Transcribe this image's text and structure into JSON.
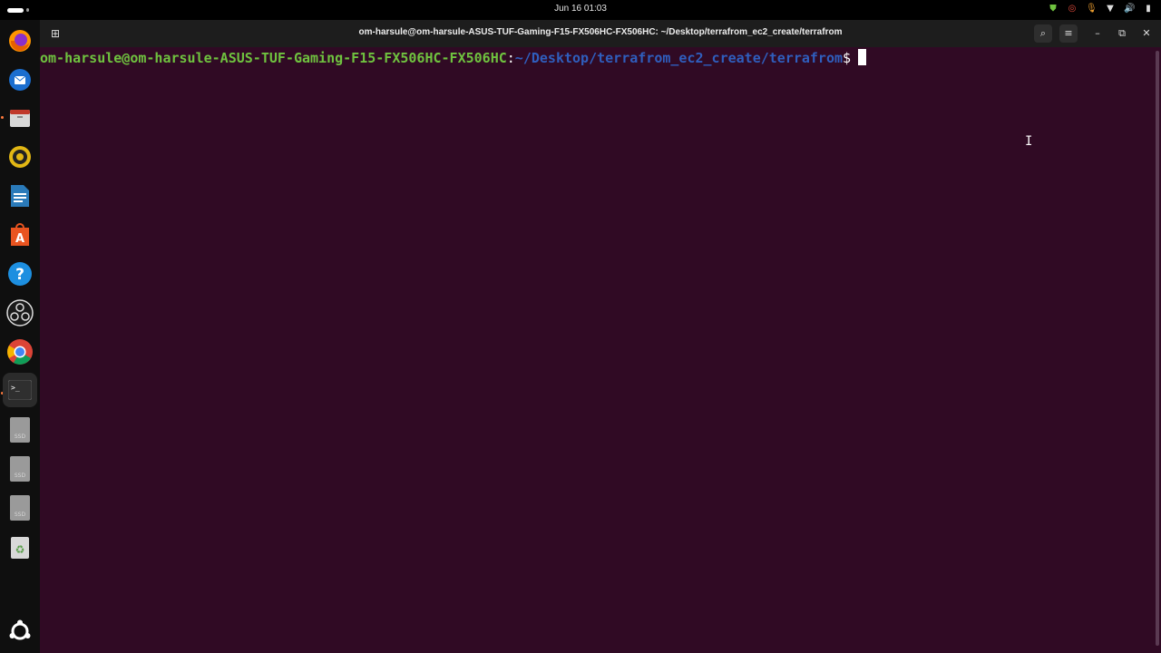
{
  "topbar": {
    "clock": "Jun 16  01:03",
    "tray_icons": [
      "shield-icon",
      "chrome-indicator-icon",
      "microphone-icon",
      "wifi-icon",
      "volume-icon",
      "battery-icon"
    ]
  },
  "dock": {
    "items": [
      {
        "name": "firefox",
        "icon": "firefox-icon",
        "glyph": "🦊",
        "color": "#e66000"
      },
      {
        "name": "thunderbird",
        "icon": "thunderbird-icon",
        "glyph": "✉",
        "color": "#1b6ecf"
      },
      {
        "name": "files",
        "icon": "files-icon",
        "glyph": "▭",
        "color": "#c0392b"
      },
      {
        "name": "rhythmbox",
        "icon": "rhythmbox-icon",
        "glyph": "◉",
        "color": "#e2b714"
      },
      {
        "name": "writer",
        "icon": "libreoffice-writer-icon",
        "glyph": "≣",
        "color": "#2a7ab9"
      },
      {
        "name": "app-center",
        "icon": "app-center-icon",
        "glyph": "A",
        "color": "#e95420"
      },
      {
        "name": "help",
        "icon": "help-icon",
        "glyph": "?",
        "color": "#1d8fe0"
      },
      {
        "name": "obs",
        "icon": "obs-studio-icon",
        "glyph": "◎",
        "color": "#2b2b2b"
      },
      {
        "name": "chrome",
        "icon": "chrome-icon",
        "glyph": "◎",
        "color": "#db4437"
      },
      {
        "name": "terminal",
        "icon": "terminal-icon",
        "glyph": ">_",
        "color": "#2b2b2b"
      },
      {
        "name": "ssd-1",
        "icon": "drive-icon",
        "glyph": "SSD",
        "color": "#8a8a8a"
      },
      {
        "name": "ssd-2",
        "icon": "drive-icon",
        "glyph": "SSD",
        "color": "#8a8a8a"
      },
      {
        "name": "ssd-3",
        "icon": "drive-icon",
        "glyph": "SSD",
        "color": "#8a8a8a"
      },
      {
        "name": "trash",
        "icon": "trash-icon",
        "glyph": "♻",
        "color": "#5a9e4b"
      }
    ],
    "show_apps_icon": "ubuntu-logo-icon"
  },
  "window": {
    "title": "om-harsule@om-harsule-ASUS-TUF-Gaming-F15-FX506HC-FX506HC: ~/Desktop/terrafrom_ec2_create/terrafrom"
  },
  "terminal": {
    "user_host": "om-harsule@om-harsule-ASUS-TUF-Gaming-F15-FX506HC-FX506HC",
    "separator": ":",
    "path": "~/Desktop/terrafrom_ec2_create/terrafrom",
    "prompt_symbol": "$",
    "colors": {
      "background": "#300a24",
      "user": "#6fc23f",
      "path": "#2f5ebd"
    }
  }
}
